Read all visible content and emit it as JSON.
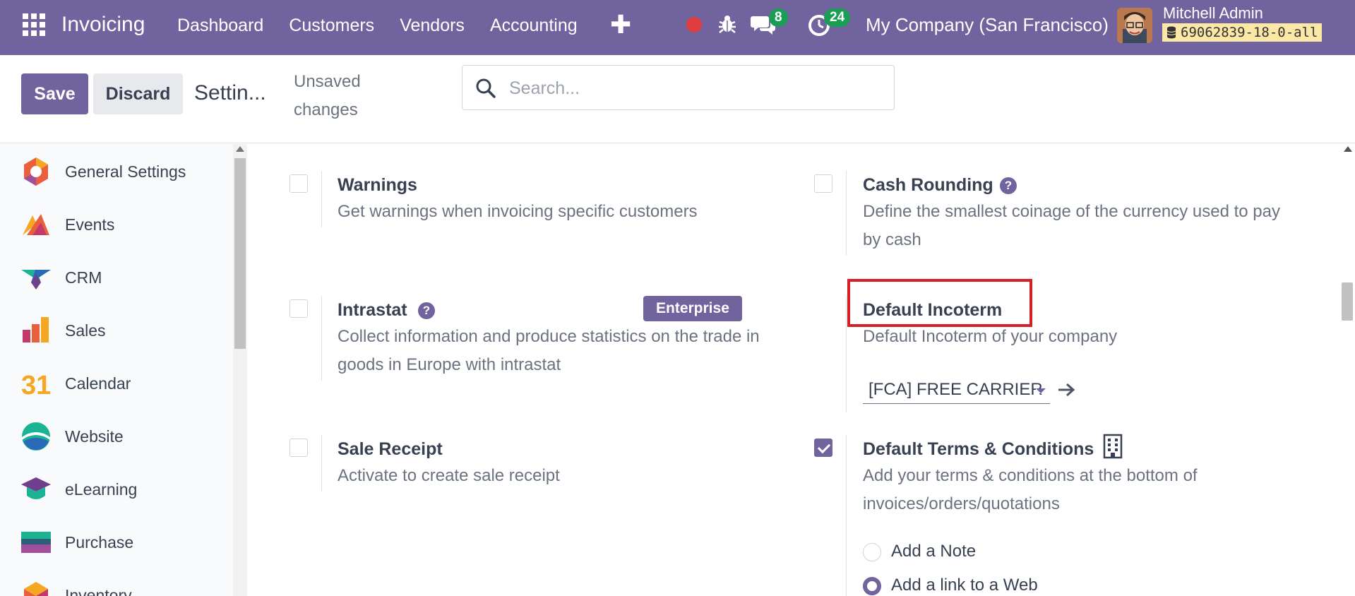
{
  "navbar": {
    "app_name": "Invoicing",
    "menu": [
      "Dashboard",
      "Customers",
      "Vendors",
      "Accounting"
    ],
    "plus_label": "✚",
    "chat_count": "8",
    "activity_count": "24",
    "company": "My Company (San Francisco)",
    "user_name": "Mitchell Admin",
    "database": "69062839-18-0-all"
  },
  "control": {
    "save_label": "Save",
    "discard_label": "Discard",
    "title": "Settin...",
    "unsaved": "Unsaved changes",
    "search_placeholder": "Search..."
  },
  "sidebar": {
    "items": [
      {
        "label": "General Settings",
        "icon": "general-settings-icon"
      },
      {
        "label": "Events",
        "icon": "events-icon"
      },
      {
        "label": "CRM",
        "icon": "crm-icon"
      },
      {
        "label": "Sales",
        "icon": "sales-icon"
      },
      {
        "label": "Calendar",
        "icon": "calendar-icon"
      },
      {
        "label": "Website",
        "icon": "website-icon"
      },
      {
        "label": "eLearning",
        "icon": "elearning-icon"
      },
      {
        "label": "Purchase",
        "icon": "purchase-icon"
      },
      {
        "label": "Inventory",
        "icon": "inventory-icon"
      }
    ],
    "calendar_icon_text": "31"
  },
  "settings": {
    "warnings": {
      "title": "Warnings",
      "desc": "Get warnings when invoicing specific customers",
      "checked": false
    },
    "cash_rounding": {
      "title": "Cash Rounding",
      "desc": "Define the smallest coinage of the currency used to pay by cash",
      "checked": false
    },
    "intrastat": {
      "title": "Intrastat",
      "desc": "Collect information and produce statistics on the trade in goods in Europe with intrastat",
      "badge": "Enterprise",
      "checked": false
    },
    "default_incoterm": {
      "title": "Default Incoterm",
      "desc": "Default Incoterm of your company",
      "value": "[FCA] FREE CARRIER"
    },
    "sale_receipt": {
      "title": "Sale Receipt",
      "desc": "Activate to create sale receipt",
      "checked": false
    },
    "default_terms": {
      "title": "Default Terms & Conditions",
      "desc": "Add your terms & conditions at the bottom of invoices/orders/quotations",
      "checked": true,
      "options": [
        "Add a Note",
        "Add a link to a Web"
      ],
      "selected_option": "Add a link to a Web"
    }
  },
  "colors": {
    "brand": "#71639e",
    "highlight": "#d81f28",
    "badge_green": "#1a9e54"
  }
}
